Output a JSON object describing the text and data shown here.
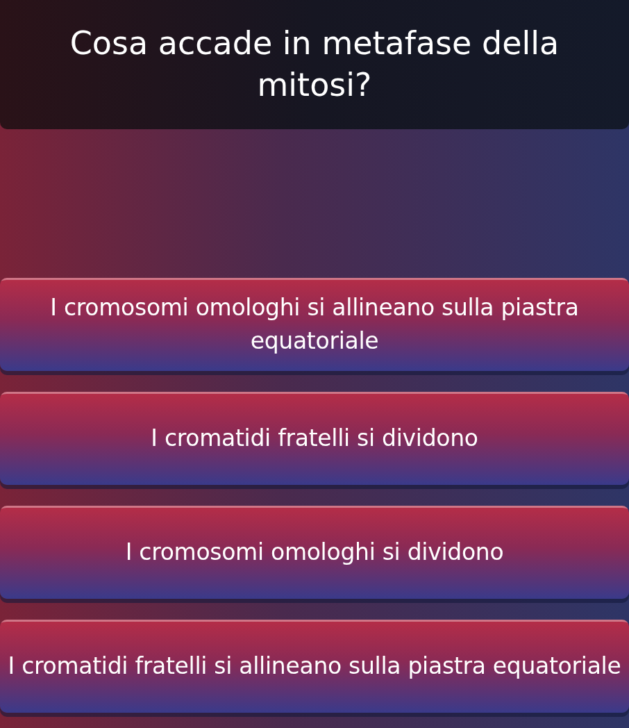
{
  "question": "Cosa accade in metafase della mitosi?",
  "answers": [
    {
      "text": "I cromosomi omologhi si allineano sulla piastra equatoriale"
    },
    {
      "text": "I cromatidi fratelli si dividono"
    },
    {
      "text": "I cromosomi omologhi si dividono"
    },
    {
      "text": "I cromatidi fratelli si allineano sulla piastra equatoriale"
    }
  ]
}
